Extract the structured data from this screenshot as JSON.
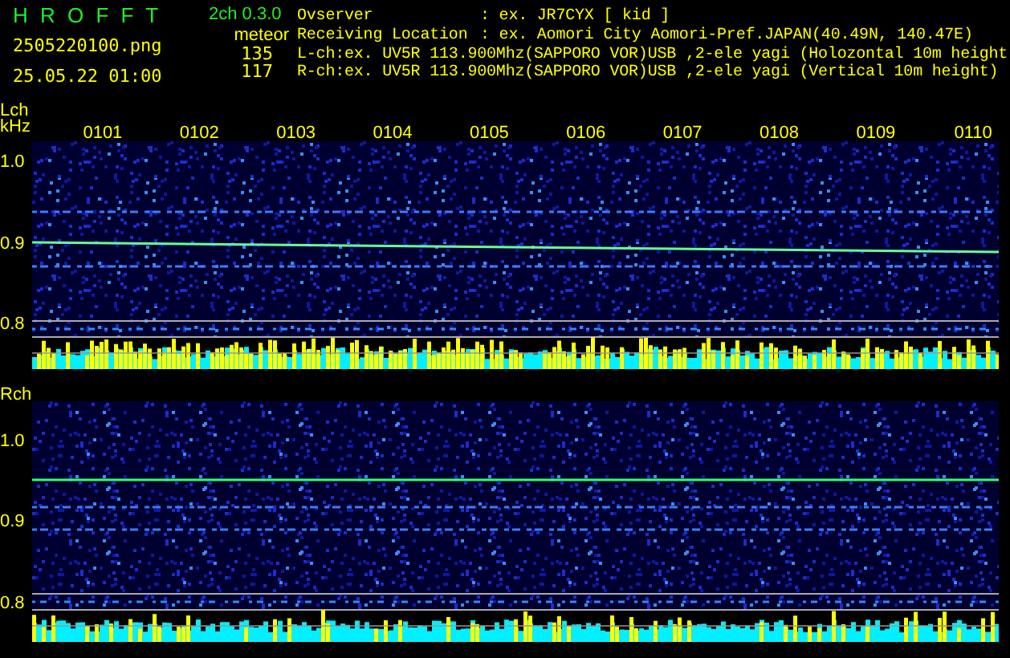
{
  "header": {
    "app_name": "H R O F F T",
    "version": "2ch 0.3.0",
    "filename": "2505220100.png",
    "datetime": "25.05.22 01:00",
    "meteor_label": "meteor",
    "counts": [
      "135",
      "117"
    ],
    "info": [
      {
        "label": "Ovserver",
        "value": ": ex. JR7CYX [ kid ]"
      },
      {
        "label": "Receiving Location",
        "value": ": ex. Aomori City Aomori-Pref.JAPAN(40.49N, 140.47E)"
      }
    ],
    "channels": [
      "L-ch:ex. UV5R 113.900Mhz(SAPPORO VOR)USB ,2-ele yagi (Holozontal 10m height",
      "R-ch:ex. UV5R 113.900Mhz(SAPPORO VOR)USB ,2-ele yagi (Vertical 10m height)"
    ]
  },
  "panels": [
    {
      "label": "Lch",
      "unit": "kHz",
      "time_labels": [
        "0101",
        "0102",
        "0103",
        "0104",
        "0105",
        "0106",
        "0107",
        "0108",
        "0109",
        "0110"
      ],
      "y_labels": [
        "1.0",
        "0.9",
        "0.8"
      ]
    },
    {
      "label": "Rch",
      "y_labels": [
        "1.0",
        "0.9",
        "0.8"
      ]
    }
  ]
}
